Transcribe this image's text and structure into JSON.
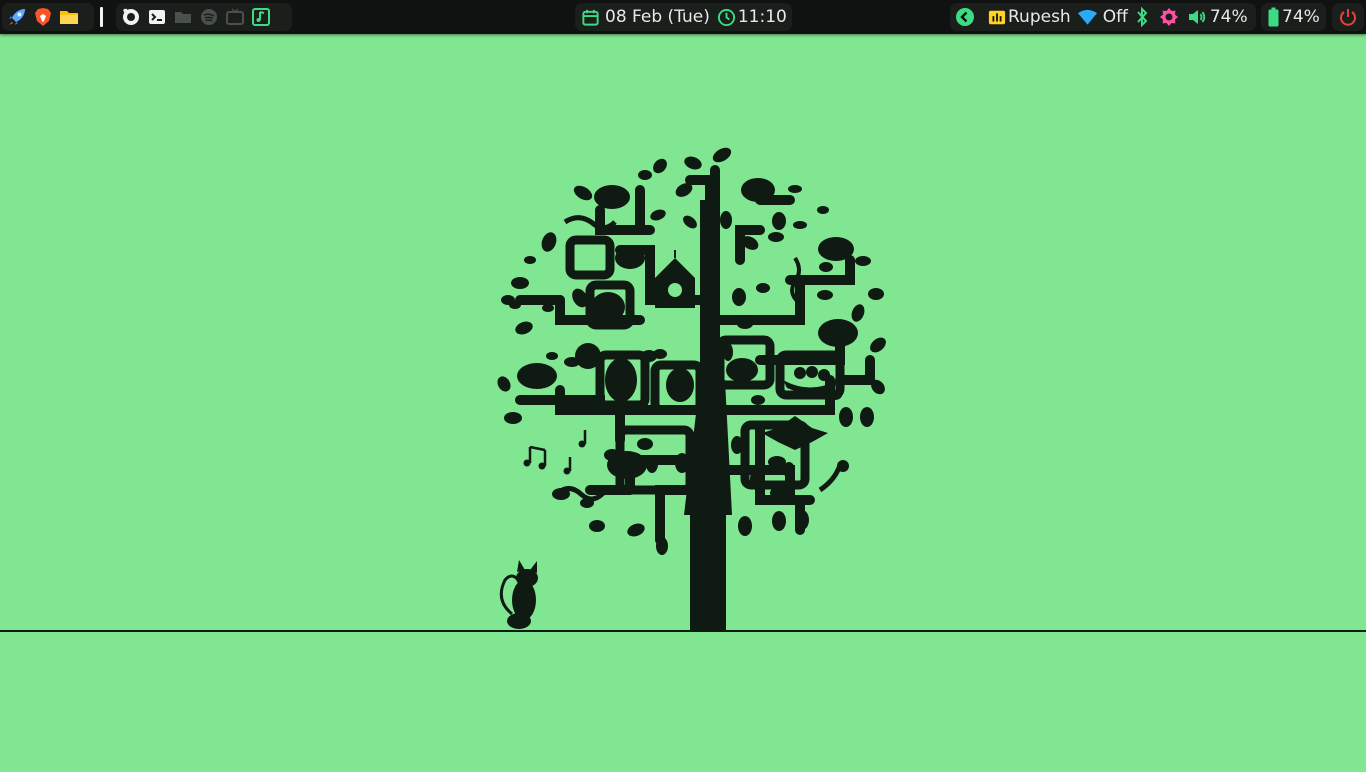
{
  "taskbar": {
    "left_apps": [
      {
        "name": "rocket-launcher-icon",
        "interactable": true
      },
      {
        "name": "brave-browser-icon",
        "interactable": true
      },
      {
        "name": "files-folder-icon",
        "interactable": true
      }
    ],
    "workspace_apps": [
      {
        "name": "firefox-icon",
        "active": true
      },
      {
        "name": "terminal-icon",
        "active": true
      },
      {
        "name": "folder-icon",
        "active": false
      },
      {
        "name": "spotify-icon",
        "active": false
      },
      {
        "name": "tv-icon",
        "active": false
      },
      {
        "name": "music-player-icon",
        "active": true
      }
    ],
    "date": "08 Feb (Tue)",
    "time": "11:10",
    "user": "Rupesh",
    "wifi": "Off",
    "volume": "74%",
    "battery": "74%"
  },
  "colors": {
    "wallpaper": "#81e691",
    "bar": "#0f1210",
    "accent_green": "#3ddc84",
    "pink": "#ff4fa3",
    "blue": "#2aa9ff",
    "yellow": "#ffd21f",
    "power_red": "#e8413d",
    "silhouette": "#0f1a12"
  },
  "wallpaper": {
    "subject": "tree-with-animals-and-cat-on-wire"
  }
}
